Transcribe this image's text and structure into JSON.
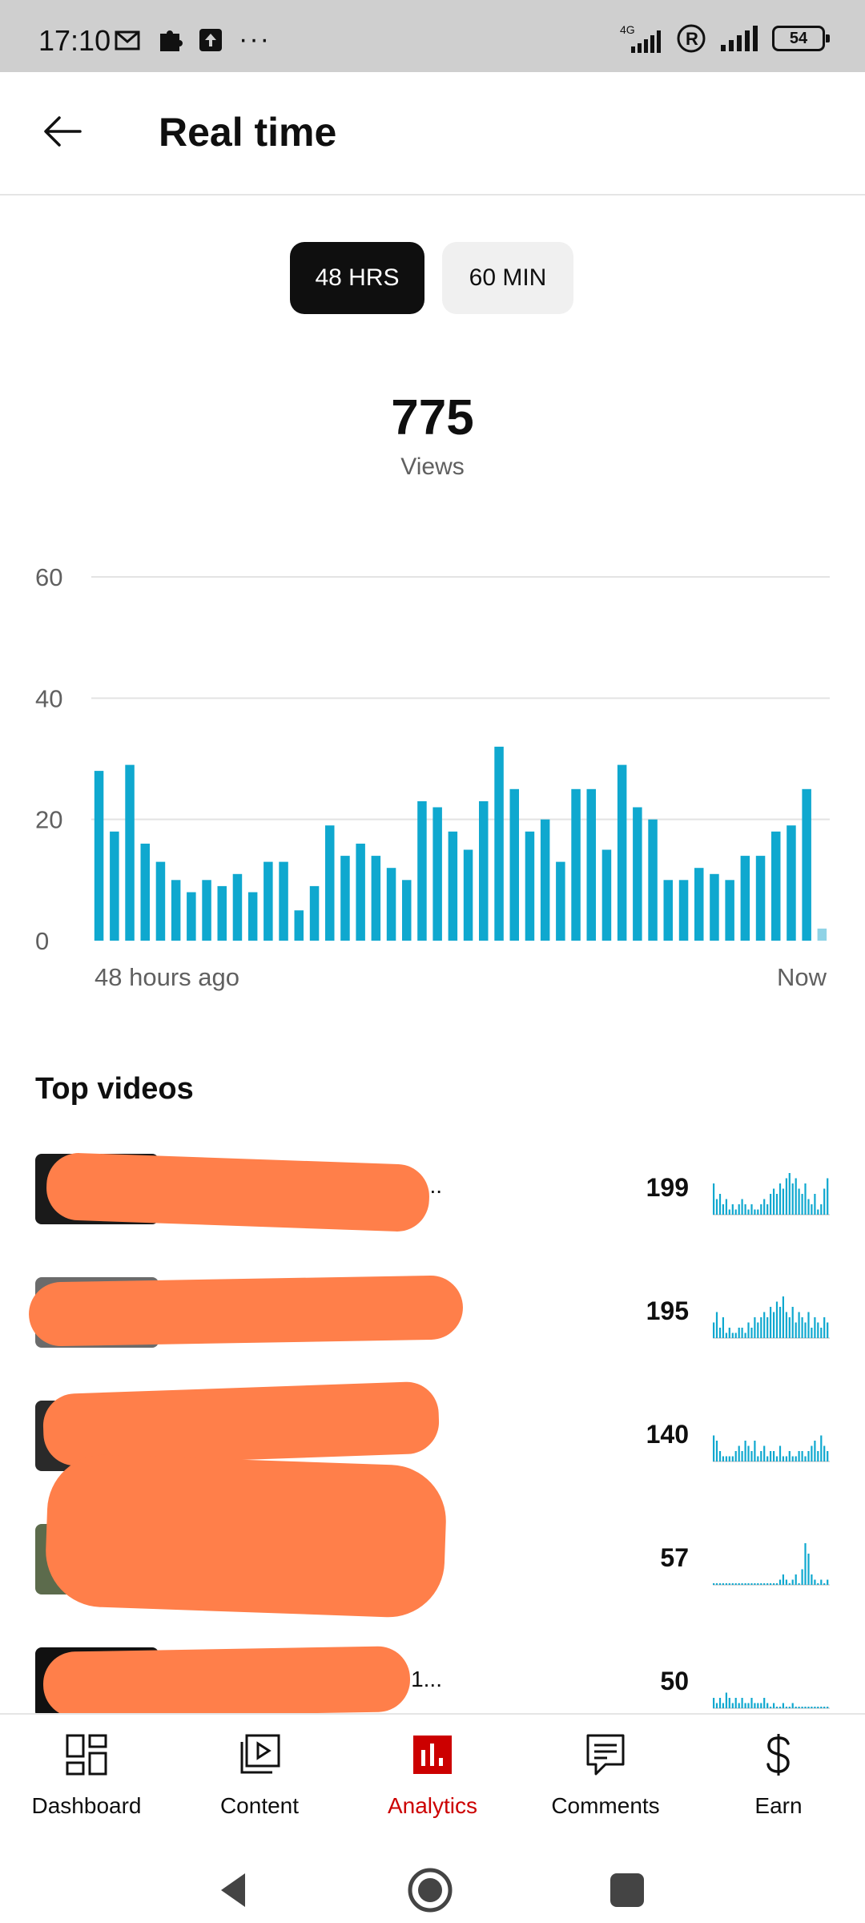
{
  "status_bar": {
    "time": "17:10",
    "battery": "54",
    "network": "4G"
  },
  "header": {
    "title": "Real time"
  },
  "range_toggle": {
    "options": [
      "48 HRS",
      "60 MIN"
    ],
    "selected": "48 HRS"
  },
  "summary": {
    "total": "775",
    "label": "Views"
  },
  "chart_data": {
    "type": "bar",
    "y_ticks": [
      "60",
      "40",
      "20",
      "0"
    ],
    "ylim": [
      0,
      60
    ],
    "x_start_label": "48 hours ago",
    "x_end_label": "Now",
    "values": [
      28,
      18,
      29,
      16,
      13,
      10,
      8,
      10,
      9,
      11,
      8,
      13,
      13,
      5,
      9,
      19,
      14,
      16,
      14,
      12,
      10,
      23,
      22,
      18,
      15,
      23,
      32,
      25,
      18,
      20,
      13,
      25,
      25,
      15,
      29,
      22,
      20,
      10,
      10,
      12,
      11,
      10,
      14,
      14,
      18,
      19,
      25,
      2
    ],
    "bar_color": "#0fa8cf",
    "last_bar_color": "#8fd3e6",
    "grid": true
  },
  "top_videos": {
    "title": "Top videos",
    "items": [
      {
        "title_tail": "..",
        "views": "199"
      },
      {
        "title_tail": "",
        "views": "195"
      },
      {
        "title_tail": "",
        "views": "140"
      },
      {
        "title_tail": "",
        "views": "57"
      },
      {
        "title_tail": "1...",
        "views": "50"
      }
    ]
  },
  "bottom_nav": {
    "items": [
      "Dashboard",
      "Content",
      "Analytics",
      "Comments",
      "Earn"
    ],
    "active": "Analytics",
    "active_color": "#cc0000"
  }
}
